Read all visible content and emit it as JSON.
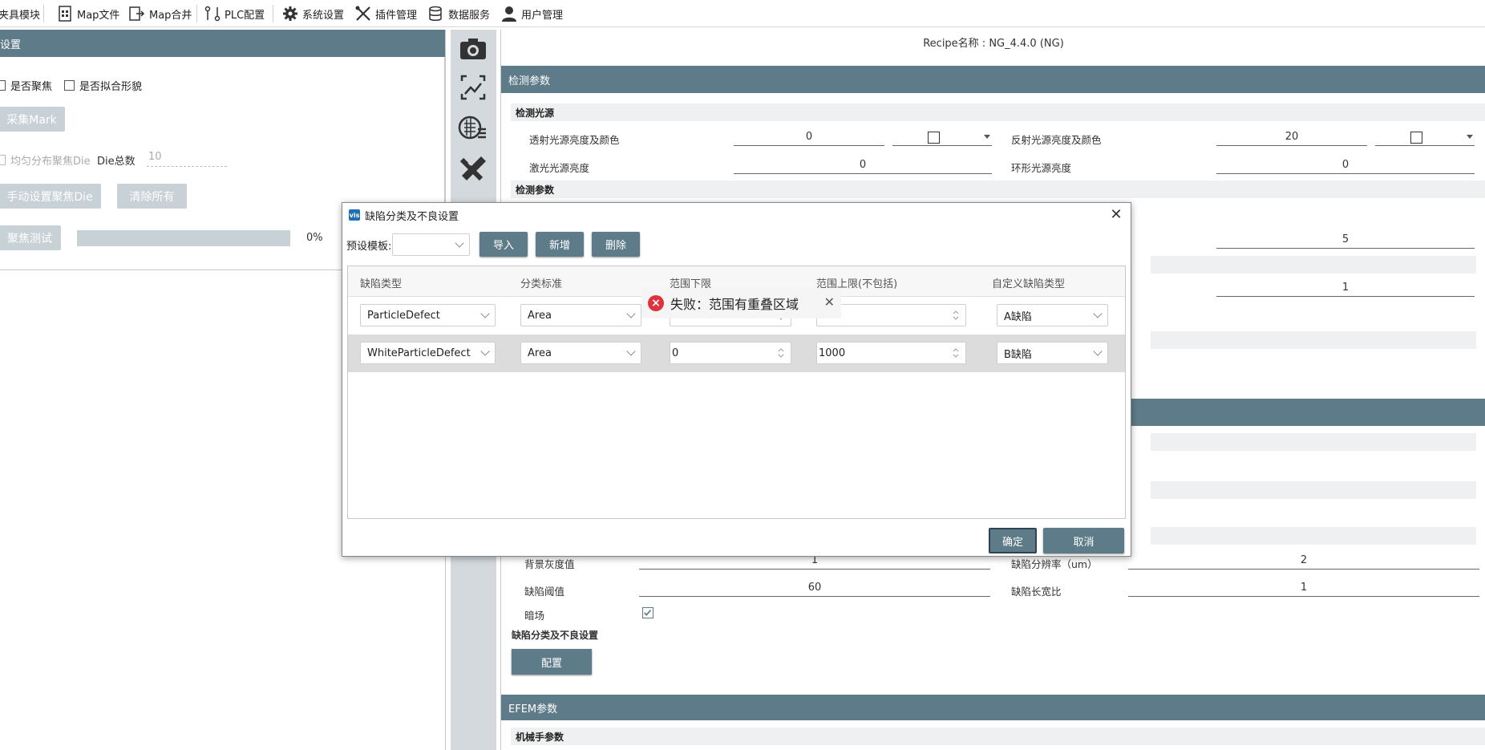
{
  "menu": {
    "items": [
      {
        "label": "夹具模块",
        "icon": "fixture-icon"
      },
      {
        "label": "Map文件",
        "icon": "map-file-icon"
      },
      {
        "label": "Map合并",
        "icon": "map-merge-icon"
      },
      {
        "label": "PLC配置",
        "icon": "plc-icon"
      },
      {
        "label": "系统设置",
        "icon": "gear-icon"
      },
      {
        "label": "插件管理",
        "icon": "tools-icon"
      },
      {
        "label": "数据服务",
        "icon": "database-icon"
      },
      {
        "label": "用户管理",
        "icon": "user-icon"
      }
    ]
  },
  "left": {
    "header": "设置",
    "focus_label": "是否聚焦",
    "fit_shape_label": "是否拟合形貌",
    "collect_mark": "采集Mark",
    "uniform_focus_die": "均匀分布聚焦Die",
    "die_total_label": "Die总数",
    "die_total_value": "10",
    "manual_focus_die": "手动设置聚焦Die",
    "clear_all": "清除所有",
    "focus_test": "聚焦测试",
    "progress_text": "0%"
  },
  "right": {
    "recipe": "Recipe名称 : NG_4.4.0 (NG)",
    "detect_params_header": "检测参数",
    "light_source": "检测光源",
    "transmitted_label": "透射光源亮度及颜色",
    "transmitted_value": "0",
    "reflected_label": "反射光源亮度及颜色",
    "reflected_value": "20",
    "laser_label": "激光光源亮度",
    "laser_value": "0",
    "ring_label": "环形光源亮度",
    "ring_value": "0",
    "detect_params_sub": "检测参数",
    "value_5": "5",
    "value_1": "1",
    "bg_gray_label": "背景灰度值",
    "bg_gray_value": "1",
    "defect_res_label": "缺陷分辨率（um）",
    "defect_res_value": "2",
    "defect_threshold_label": "缺陷阈值",
    "defect_threshold_value": "60",
    "defect_ratio_label": "缺陷长宽比",
    "defect_ratio_value": "1",
    "dark_field_label": "暗场",
    "defect_class_sub": "缺陷分类及不良设置",
    "config_btn": "配置",
    "efem_header": "EFEM参数",
    "robot_sub": "机械手参数"
  },
  "modal": {
    "title": "缺陷分类及不良设置",
    "preset_label": "预设模板:",
    "preset_value": "",
    "import_btn": "导入",
    "add_btn": "新增",
    "delete_btn": "删除",
    "columns": [
      "缺陷类型",
      "分类标准",
      "范围下限",
      "范围上限(不包括)",
      "自定义缺陷类型"
    ],
    "rows": [
      {
        "type": "ParticleDefect",
        "standard": "Area",
        "lower": "",
        "upper": "",
        "custom": "A缺陷"
      },
      {
        "type": "WhiteParticleDefect",
        "standard": "Area",
        "lower": "0",
        "upper": "1000",
        "custom": "B缺陷"
      }
    ],
    "toast": "失败：范围有重叠区域",
    "ok_btn": "确定",
    "cancel_btn": "取消"
  },
  "colors": {
    "accent": "#5e7b89",
    "disabled": "#c7d1d6",
    "error": "#e0323c"
  }
}
